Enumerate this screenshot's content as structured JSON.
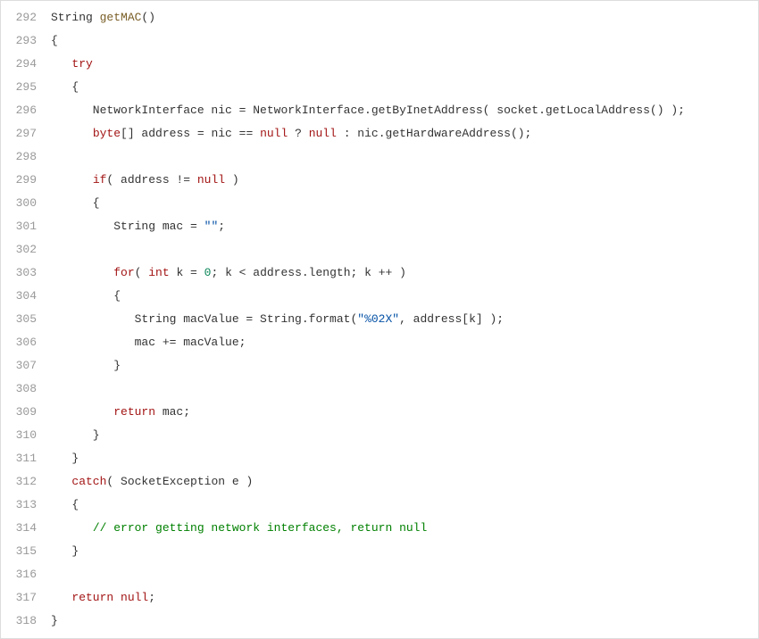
{
  "code": {
    "startLine": 292,
    "lines": [
      [
        {
          "c": "type",
          "t": "String "
        },
        {
          "c": "fn",
          "t": "getMAC"
        },
        {
          "c": "",
          "t": "()"
        }
      ],
      [
        {
          "c": "",
          "t": "{"
        }
      ],
      [
        {
          "c": "",
          "t": "   "
        },
        {
          "c": "kw",
          "t": "try"
        }
      ],
      [
        {
          "c": "",
          "t": "   {"
        }
      ],
      [
        {
          "c": "",
          "t": "      NetworkInterface nic = NetworkInterface.getByInetAddress( socket.getLocalAddress() );"
        }
      ],
      [
        {
          "c": "",
          "t": "      "
        },
        {
          "c": "kw",
          "t": "byte"
        },
        {
          "c": "",
          "t": "[] address = nic == "
        },
        {
          "c": "kw",
          "t": "null"
        },
        {
          "c": "",
          "t": " ? "
        },
        {
          "c": "kw",
          "t": "null"
        },
        {
          "c": "",
          "t": " : nic.getHardwareAddress();"
        }
      ],
      [
        {
          "c": "",
          "t": ""
        }
      ],
      [
        {
          "c": "",
          "t": "      "
        },
        {
          "c": "kw",
          "t": "if"
        },
        {
          "c": "",
          "t": "( address != "
        },
        {
          "c": "kw",
          "t": "null"
        },
        {
          "c": "",
          "t": " )"
        }
      ],
      [
        {
          "c": "",
          "t": "      {"
        }
      ],
      [
        {
          "c": "",
          "t": "         String mac = "
        },
        {
          "c": "str",
          "t": "\"\""
        },
        {
          "c": "",
          "t": ";"
        }
      ],
      [
        {
          "c": "",
          "t": ""
        }
      ],
      [
        {
          "c": "",
          "t": "         "
        },
        {
          "c": "kw",
          "t": "for"
        },
        {
          "c": "",
          "t": "( "
        },
        {
          "c": "kw",
          "t": "int"
        },
        {
          "c": "",
          "t": " k = "
        },
        {
          "c": "num",
          "t": "0"
        },
        {
          "c": "",
          "t": "; k < address.length; k ++ )"
        }
      ],
      [
        {
          "c": "",
          "t": "         {"
        }
      ],
      [
        {
          "c": "",
          "t": "            String macValue = String.format("
        },
        {
          "c": "str",
          "t": "\"%02X\""
        },
        {
          "c": "",
          "t": ", address[k] );"
        }
      ],
      [
        {
          "c": "",
          "t": "            mac += macValue;"
        }
      ],
      [
        {
          "c": "",
          "t": "         }"
        }
      ],
      [
        {
          "c": "",
          "t": ""
        }
      ],
      [
        {
          "c": "",
          "t": "         "
        },
        {
          "c": "kw",
          "t": "return"
        },
        {
          "c": "",
          "t": " mac;"
        }
      ],
      [
        {
          "c": "",
          "t": "      }"
        }
      ],
      [
        {
          "c": "",
          "t": "   }"
        }
      ],
      [
        {
          "c": "",
          "t": "   "
        },
        {
          "c": "kw",
          "t": "catch"
        },
        {
          "c": "",
          "t": "( SocketException e )"
        }
      ],
      [
        {
          "c": "",
          "t": "   {"
        }
      ],
      [
        {
          "c": "",
          "t": "      "
        },
        {
          "c": "cmt",
          "t": "// error getting network interfaces, return null"
        }
      ],
      [
        {
          "c": "",
          "t": "   }"
        }
      ],
      [
        {
          "c": "",
          "t": ""
        }
      ],
      [
        {
          "c": "",
          "t": "   "
        },
        {
          "c": "kw",
          "t": "return"
        },
        {
          "c": "",
          "t": " "
        },
        {
          "c": "kw",
          "t": "null"
        },
        {
          "c": "",
          "t": ";"
        }
      ],
      [
        {
          "c": "",
          "t": "}"
        }
      ]
    ]
  }
}
